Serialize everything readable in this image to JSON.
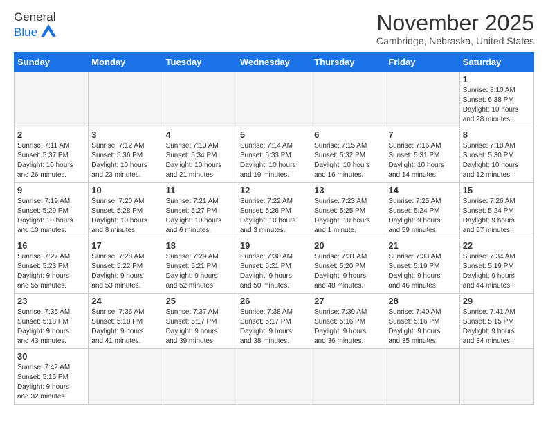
{
  "header": {
    "logo_general": "General",
    "logo_blue": "Blue",
    "month_year": "November 2025",
    "location": "Cambridge, Nebraska, United States"
  },
  "weekdays": [
    "Sunday",
    "Monday",
    "Tuesday",
    "Wednesday",
    "Thursday",
    "Friday",
    "Saturday"
  ],
  "days": [
    {
      "day": "",
      "info": ""
    },
    {
      "day": "",
      "info": ""
    },
    {
      "day": "",
      "info": ""
    },
    {
      "day": "",
      "info": ""
    },
    {
      "day": "",
      "info": ""
    },
    {
      "day": "",
      "info": ""
    },
    {
      "day": "1",
      "info": "Sunrise: 8:10 AM\nSunset: 6:38 PM\nDaylight: 10 hours\nand 28 minutes."
    },
    {
      "day": "2",
      "info": "Sunrise: 7:11 AM\nSunset: 5:37 PM\nDaylight: 10 hours\nand 26 minutes."
    },
    {
      "day": "3",
      "info": "Sunrise: 7:12 AM\nSunset: 5:36 PM\nDaylight: 10 hours\nand 23 minutes."
    },
    {
      "day": "4",
      "info": "Sunrise: 7:13 AM\nSunset: 5:34 PM\nDaylight: 10 hours\nand 21 minutes."
    },
    {
      "day": "5",
      "info": "Sunrise: 7:14 AM\nSunset: 5:33 PM\nDaylight: 10 hours\nand 19 minutes."
    },
    {
      "day": "6",
      "info": "Sunrise: 7:15 AM\nSunset: 5:32 PM\nDaylight: 10 hours\nand 16 minutes."
    },
    {
      "day": "7",
      "info": "Sunrise: 7:16 AM\nSunset: 5:31 PM\nDaylight: 10 hours\nand 14 minutes."
    },
    {
      "day": "8",
      "info": "Sunrise: 7:18 AM\nSunset: 5:30 PM\nDaylight: 10 hours\nand 12 minutes."
    },
    {
      "day": "9",
      "info": "Sunrise: 7:19 AM\nSunset: 5:29 PM\nDaylight: 10 hours\nand 10 minutes."
    },
    {
      "day": "10",
      "info": "Sunrise: 7:20 AM\nSunset: 5:28 PM\nDaylight: 10 hours\nand 8 minutes."
    },
    {
      "day": "11",
      "info": "Sunrise: 7:21 AM\nSunset: 5:27 PM\nDaylight: 10 hours\nand 6 minutes."
    },
    {
      "day": "12",
      "info": "Sunrise: 7:22 AM\nSunset: 5:26 PM\nDaylight: 10 hours\nand 3 minutes."
    },
    {
      "day": "13",
      "info": "Sunrise: 7:23 AM\nSunset: 5:25 PM\nDaylight: 10 hours\nand 1 minute."
    },
    {
      "day": "14",
      "info": "Sunrise: 7:25 AM\nSunset: 5:24 PM\nDaylight: 9 hours\nand 59 minutes."
    },
    {
      "day": "15",
      "info": "Sunrise: 7:26 AM\nSunset: 5:24 PM\nDaylight: 9 hours\nand 57 minutes."
    },
    {
      "day": "16",
      "info": "Sunrise: 7:27 AM\nSunset: 5:23 PM\nDaylight: 9 hours\nand 55 minutes."
    },
    {
      "day": "17",
      "info": "Sunrise: 7:28 AM\nSunset: 5:22 PM\nDaylight: 9 hours\nand 53 minutes."
    },
    {
      "day": "18",
      "info": "Sunrise: 7:29 AM\nSunset: 5:21 PM\nDaylight: 9 hours\nand 52 minutes."
    },
    {
      "day": "19",
      "info": "Sunrise: 7:30 AM\nSunset: 5:21 PM\nDaylight: 9 hours\nand 50 minutes."
    },
    {
      "day": "20",
      "info": "Sunrise: 7:31 AM\nSunset: 5:20 PM\nDaylight: 9 hours\nand 48 minutes."
    },
    {
      "day": "21",
      "info": "Sunrise: 7:33 AM\nSunset: 5:19 PM\nDaylight: 9 hours\nand 46 minutes."
    },
    {
      "day": "22",
      "info": "Sunrise: 7:34 AM\nSunset: 5:19 PM\nDaylight: 9 hours\nand 44 minutes."
    },
    {
      "day": "23",
      "info": "Sunrise: 7:35 AM\nSunset: 5:18 PM\nDaylight: 9 hours\nand 43 minutes."
    },
    {
      "day": "24",
      "info": "Sunrise: 7:36 AM\nSunset: 5:18 PM\nDaylight: 9 hours\nand 41 minutes."
    },
    {
      "day": "25",
      "info": "Sunrise: 7:37 AM\nSunset: 5:17 PM\nDaylight: 9 hours\nand 39 minutes."
    },
    {
      "day": "26",
      "info": "Sunrise: 7:38 AM\nSunset: 5:17 PM\nDaylight: 9 hours\nand 38 minutes."
    },
    {
      "day": "27",
      "info": "Sunrise: 7:39 AM\nSunset: 5:16 PM\nDaylight: 9 hours\nand 36 minutes."
    },
    {
      "day": "28",
      "info": "Sunrise: 7:40 AM\nSunset: 5:16 PM\nDaylight: 9 hours\nand 35 minutes."
    },
    {
      "day": "29",
      "info": "Sunrise: 7:41 AM\nSunset: 5:15 PM\nDaylight: 9 hours\nand 34 minutes."
    },
    {
      "day": "30",
      "info": "Sunrise: 7:42 AM\nSunset: 5:15 PM\nDaylight: 9 hours\nand 32 minutes."
    },
    {
      "day": "",
      "info": ""
    },
    {
      "day": "",
      "info": ""
    },
    {
      "day": "",
      "info": ""
    },
    {
      "day": "",
      "info": ""
    },
    {
      "day": "",
      "info": ""
    },
    {
      "day": "",
      "info": ""
    }
  ]
}
